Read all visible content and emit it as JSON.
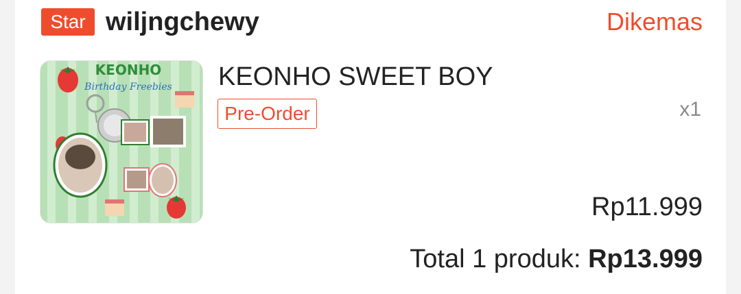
{
  "shop": {
    "badge": "Star",
    "name": "wiljngchewy",
    "status": "Dikemas"
  },
  "product": {
    "thumbnail_text_title": "KEONHO",
    "thumbnail_text_subtitle": "Birthday Freebies",
    "title": "KEONHO SWEET BOY",
    "tag": "Pre-Order",
    "quantity": "x1",
    "price": "Rp11.999"
  },
  "summary": {
    "label": "Total 1 produk: ",
    "amount": "Rp13.999"
  },
  "colors": {
    "accent": "#ee4d2d",
    "text": "#222222",
    "muted": "#8a8a8a",
    "thumb_bg": "#b8e0b6"
  }
}
